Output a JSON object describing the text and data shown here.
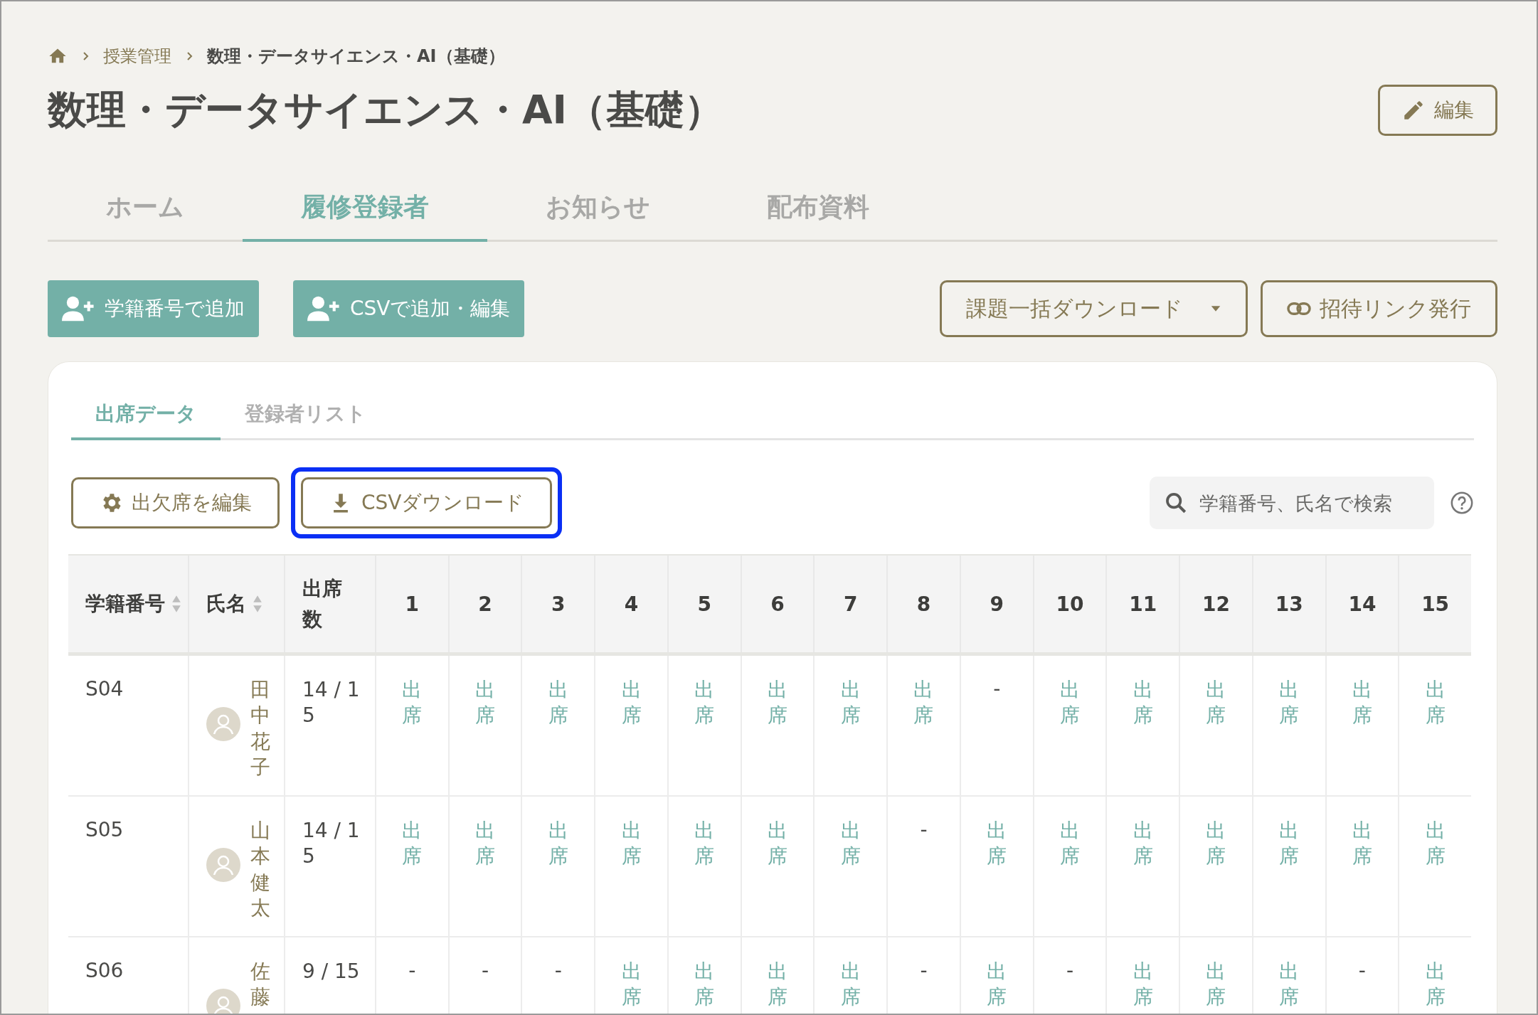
{
  "breadcrumb": [
    {
      "label": "授業管理",
      "current": false
    },
    {
      "label": "数理・データサイエンス・AI（基礎）",
      "current": true
    }
  ],
  "title": "数理・データサイエンス・AI（基礎）",
  "edit_button": "編集",
  "tabs": [
    {
      "label": "ホーム",
      "selected": false
    },
    {
      "label": "履修登録者",
      "selected": true
    },
    {
      "label": "お知らせ",
      "selected": false
    },
    {
      "label": "配布資料",
      "selected": false
    }
  ],
  "actions": [
    {
      "label": "学籍番号で追加",
      "kind": "add-user"
    },
    {
      "label": "CSVで追加・編集",
      "kind": "add-user"
    },
    {
      "label": "課題一括ダウンロード",
      "kind": "dropdown"
    },
    {
      "label": "招待リンク発行",
      "kind": "link"
    }
  ],
  "subtabs": [
    {
      "label": "出席データ",
      "selected": true
    },
    {
      "label": "登録者リスト",
      "selected": false
    }
  ],
  "tools": [
    {
      "label": "出欠席を編集",
      "kind": "gear",
      "highlighted": false
    },
    {
      "label": "CSVダウンロード",
      "kind": "download",
      "highlighted": true
    }
  ],
  "search": {
    "placeholder": "学籍番号、氏名で検索"
  },
  "table": {
    "columns": [
      {
        "label": "学籍番号",
        "sortable": true
      },
      {
        "label": "氏名",
        "sortable": true
      },
      {
        "label": "出席数",
        "sortable": false
      },
      {
        "label": "1"
      },
      {
        "label": "2"
      },
      {
        "label": "3"
      },
      {
        "label": "4"
      },
      {
        "label": "5"
      },
      {
        "label": "6"
      },
      {
        "label": "7"
      },
      {
        "label": "8"
      },
      {
        "label": "9"
      },
      {
        "label": "10"
      },
      {
        "label": "11"
      },
      {
        "label": "12"
      },
      {
        "label": "13"
      },
      {
        "label": "14"
      },
      {
        "label": "15"
      }
    ],
    "rows": [
      {
        "cells": [
          {
            "text": "S04",
            "kind": "id"
          },
          {
            "text": "田中花子",
            "kind": "name"
          },
          {
            "text": "14 / 15",
            "kind": "count"
          },
          {
            "text": "出席",
            "kind": "present"
          },
          {
            "text": "出席",
            "kind": "present"
          },
          {
            "text": "出席",
            "kind": "present"
          },
          {
            "text": "出席",
            "kind": "present"
          },
          {
            "text": "出席",
            "kind": "present"
          },
          {
            "text": "出席",
            "kind": "present"
          },
          {
            "text": "出席",
            "kind": "present"
          },
          {
            "text": "出席",
            "kind": "present"
          },
          {
            "text": "-",
            "kind": "none"
          },
          {
            "text": "出席",
            "kind": "present"
          },
          {
            "text": "出席",
            "kind": "present"
          },
          {
            "text": "出席",
            "kind": "present"
          },
          {
            "text": "出席",
            "kind": "present"
          },
          {
            "text": "出席",
            "kind": "present"
          },
          {
            "text": "出席",
            "kind": "present"
          }
        ]
      },
      {
        "cells": [
          {
            "text": "S05",
            "kind": "id"
          },
          {
            "text": "山本健太",
            "kind": "name"
          },
          {
            "text": "14 / 15",
            "kind": "count"
          },
          {
            "text": "出席",
            "kind": "present"
          },
          {
            "text": "出席",
            "kind": "present"
          },
          {
            "text": "出席",
            "kind": "present"
          },
          {
            "text": "出席",
            "kind": "present"
          },
          {
            "text": "出席",
            "kind": "present"
          },
          {
            "text": "出席",
            "kind": "present"
          },
          {
            "text": "出席",
            "kind": "present"
          },
          {
            "text": "-",
            "kind": "none"
          },
          {
            "text": "出席",
            "kind": "present"
          },
          {
            "text": "出席",
            "kind": "present"
          },
          {
            "text": "出席",
            "kind": "present"
          },
          {
            "text": "出席",
            "kind": "present"
          },
          {
            "text": "出席",
            "kind": "present"
          },
          {
            "text": "出席",
            "kind": "present"
          },
          {
            "text": "出席",
            "kind": "present"
          }
        ]
      },
      {
        "cells": [
          {
            "text": "S06",
            "kind": "id"
          },
          {
            "text": "佐藤",
            "kind": "name"
          },
          {
            "text": "9 / 15",
            "kind": "count"
          },
          {
            "text": "-",
            "kind": "none"
          },
          {
            "text": "-",
            "kind": "none"
          },
          {
            "text": "-",
            "kind": "none"
          },
          {
            "text": "出席",
            "kind": "present"
          },
          {
            "text": "出席",
            "kind": "present"
          },
          {
            "text": "出席",
            "kind": "present"
          },
          {
            "text": "出席",
            "kind": "present"
          },
          {
            "text": "-",
            "kind": "none"
          },
          {
            "text": "出席",
            "kind": "present"
          },
          {
            "text": "-",
            "kind": "none"
          },
          {
            "text": "出席",
            "kind": "present"
          },
          {
            "text": "出席",
            "kind": "present"
          },
          {
            "text": "出席",
            "kind": "present"
          },
          {
            "text": "-",
            "kind": "none"
          },
          {
            "text": "出席",
            "kind": "present"
          }
        ]
      }
    ]
  }
}
